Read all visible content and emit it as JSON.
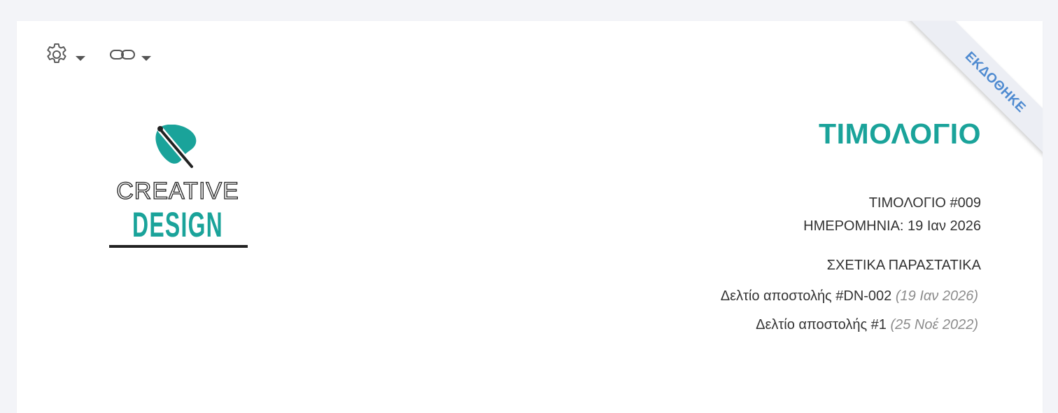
{
  "toolbar": {
    "settings_icon": "gear-icon",
    "link_icon": "link-icon"
  },
  "logo": {
    "line1": "CREATIVE",
    "line2": "DESIGN",
    "accent_color": "#1aa39a"
  },
  "document": {
    "title": "ΤΙΜΟΛΟΓΙΟ",
    "number_line": "ΤΙΜΟΛΟΓΙΟ #009",
    "date_line": "ΗΜΕΡΟΜΗΝΙΑ: 19 Ιαν 2026",
    "status": "ΕΚΔΟΘΗΚΕ",
    "status_color": "#4e8ad0"
  },
  "related": {
    "title": "ΣΧΕΤΙΚΑ ΠΑΡΑΣΤΑΤΙΚΑ",
    "items": [
      {
        "label": "Δελτίο αποστολής #DN-002",
        "date": "(19 Ιαν 2026)"
      },
      {
        "label": "Δελτίο αποστολής #1",
        "date": "(25 Νοέ 2022)"
      }
    ]
  }
}
